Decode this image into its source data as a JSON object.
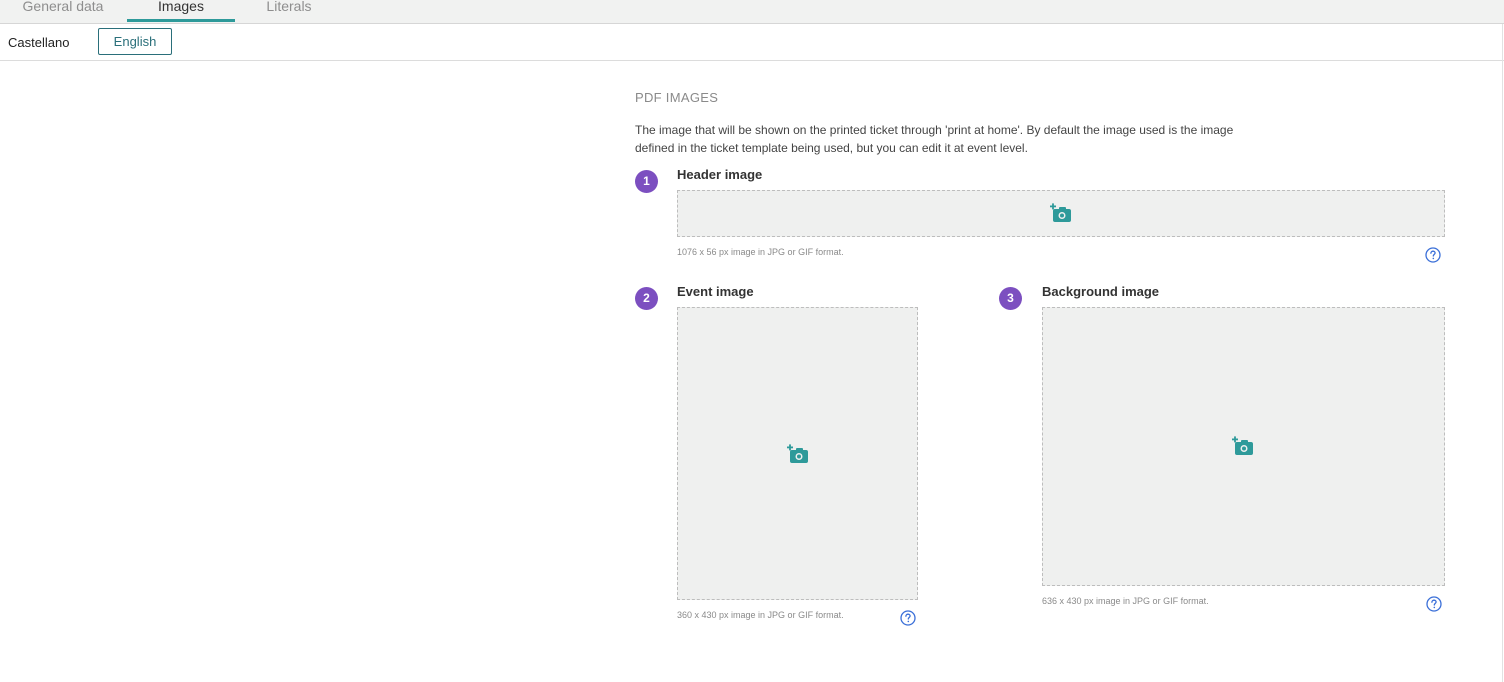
{
  "tabs": {
    "general": "General data",
    "images": "Images",
    "literals": "Literals"
  },
  "languages": {
    "castellano": "Castellano",
    "english": "English"
  },
  "section": {
    "title": "PDF IMAGES",
    "description_line1": "The image that will be shown on the printed ticket through 'print at home'. By default the image used is the image",
    "description_line2": "defined in the ticket template being used, but you can edit it at event level."
  },
  "images": {
    "header": {
      "step": "1",
      "label": "Header image",
      "hint": "1076 x 56 px image in JPG or GIF format."
    },
    "event": {
      "step": "2",
      "label": "Event image",
      "hint": "360 x 430 px image in JPG or GIF format."
    },
    "background": {
      "step": "3",
      "label": "Background image",
      "hint": "636 x 430 px image in JPG or GIF format."
    }
  },
  "icons": {
    "upload": "add-photo-icon",
    "help": "help-circle-icon"
  },
  "colors": {
    "accent": "#2e9a9a",
    "step_badge": "#7c4fc0",
    "help_icon": "#3a6fd8",
    "dropzone_bg": "#eff0ef"
  }
}
